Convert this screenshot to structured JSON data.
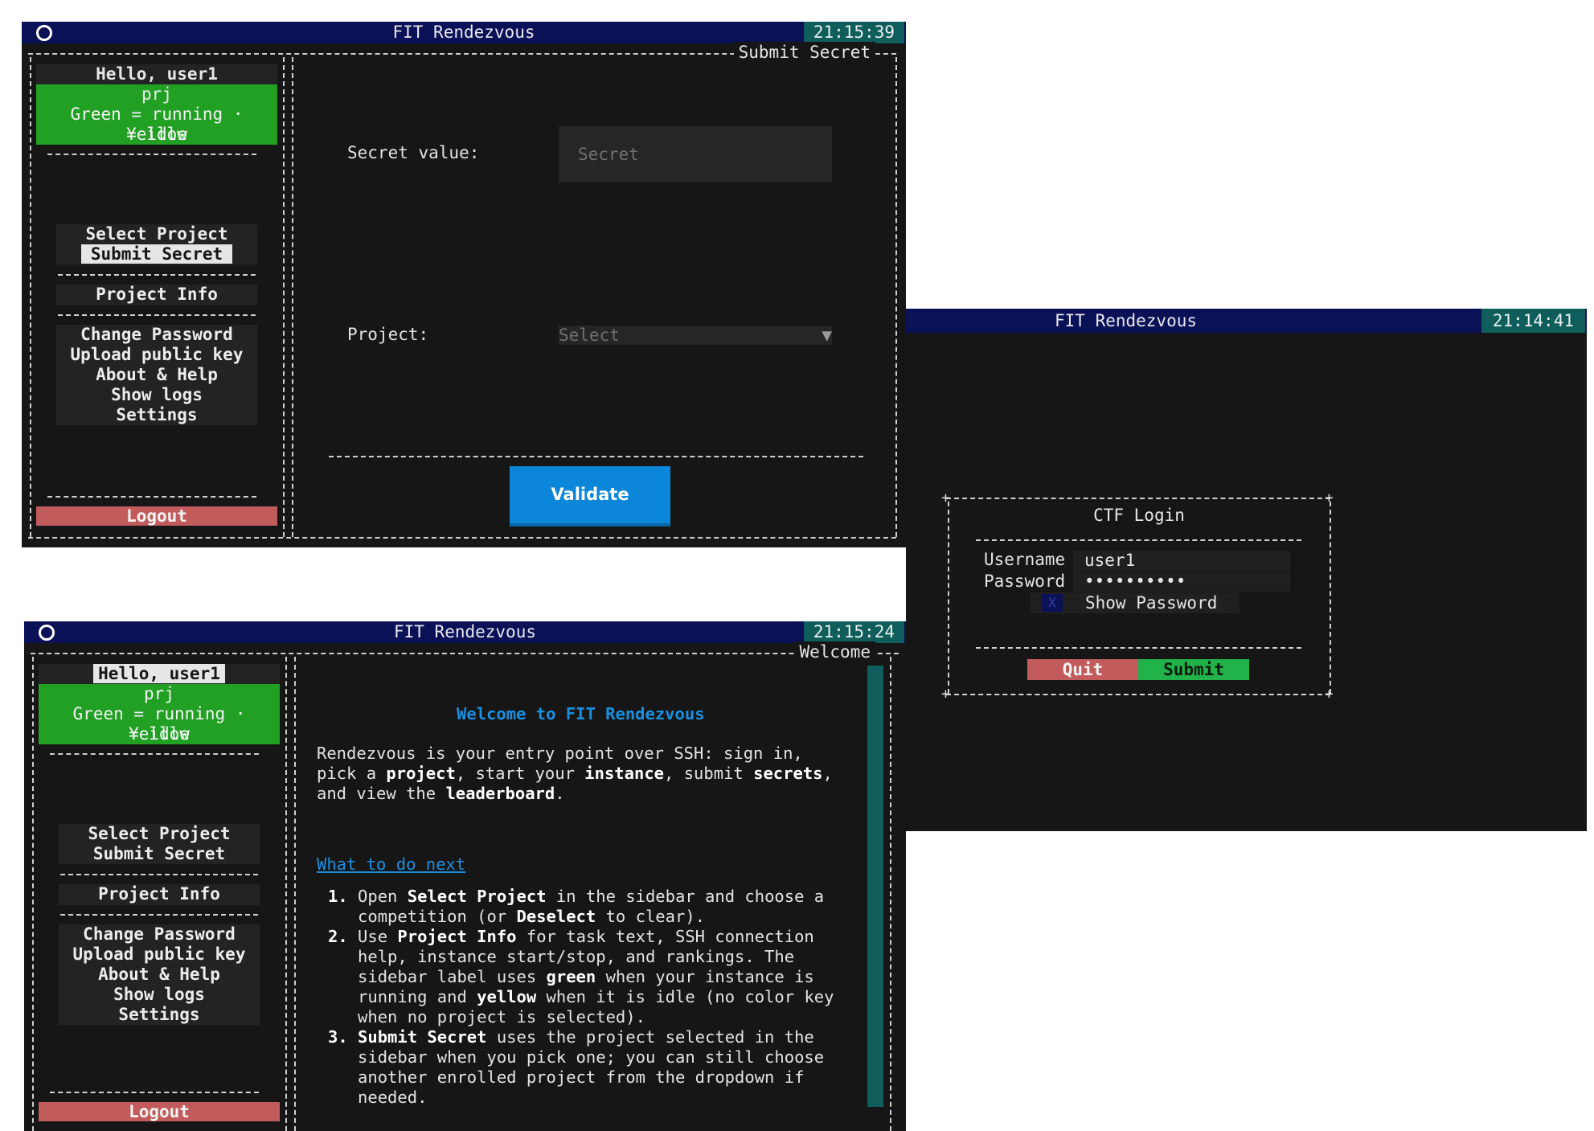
{
  "app_title": "FIT Rendezvous",
  "windows": {
    "submit": {
      "clock": "21:15:39",
      "panel_title": "Submit Secret",
      "sidebar": {
        "greeting": "Hello, user1",
        "project": "prj",
        "legend_line1": "Green = running · Yellow",
        "legend_line2": "= idle",
        "menu": [
          "Select Project",
          "Submit Secret",
          "Project Info",
          "Change Password",
          "Upload public key",
          "About & Help",
          "Show logs",
          "Settings"
        ],
        "logout": "Logout"
      },
      "form": {
        "secret_label": "Secret value:",
        "secret_placeholder": "Secret",
        "project_label": "Project:",
        "project_select": "Select",
        "validate": "Validate"
      }
    },
    "login": {
      "clock": "21:14:41",
      "heading": "CTF Login",
      "username_label": "Username",
      "username_value": "user1",
      "password_label": "Password",
      "password_value": "••••••••••",
      "show_password": "Show Password",
      "quit": "Quit",
      "submit": "Submit"
    },
    "welcome": {
      "clock": "21:15:24",
      "panel_title": "Welcome",
      "sidebar": {
        "greeting": "Hello, user1",
        "project": "prj",
        "legend_line1": "Green = running · Yellow",
        "legend_line2": "= idle",
        "menu": [
          "Select Project",
          "Submit Secret",
          "Project Info",
          "Change Password",
          "Upload public key",
          "About & Help",
          "Show logs",
          "Settings"
        ],
        "logout": "Logout"
      },
      "content": {
        "heading": "Welcome to FIT Rendezvous",
        "intro": [
          {
            "t": "Rendezvous is your entry point over SSH: sign in,",
            "b": false
          },
          {
            "t": "pick a ",
            "b": false
          },
          {
            "t": "project",
            "b": true
          },
          {
            "t": ", start your ",
            "b": false
          },
          {
            "t": "instance",
            "b": true
          },
          {
            "t": ", submit ",
            "b": false
          },
          {
            "t": "secrets",
            "b": true
          },
          {
            "t": ",",
            "b": false
          },
          {
            "t": "and view the ",
            "b": false
          },
          {
            "t": "leaderboard",
            "b": true
          },
          {
            "t": ".",
            "b": false
          }
        ],
        "next_link": "What to do next",
        "steps": [
          "1.",
          "2.",
          "3."
        ]
      }
    }
  }
}
